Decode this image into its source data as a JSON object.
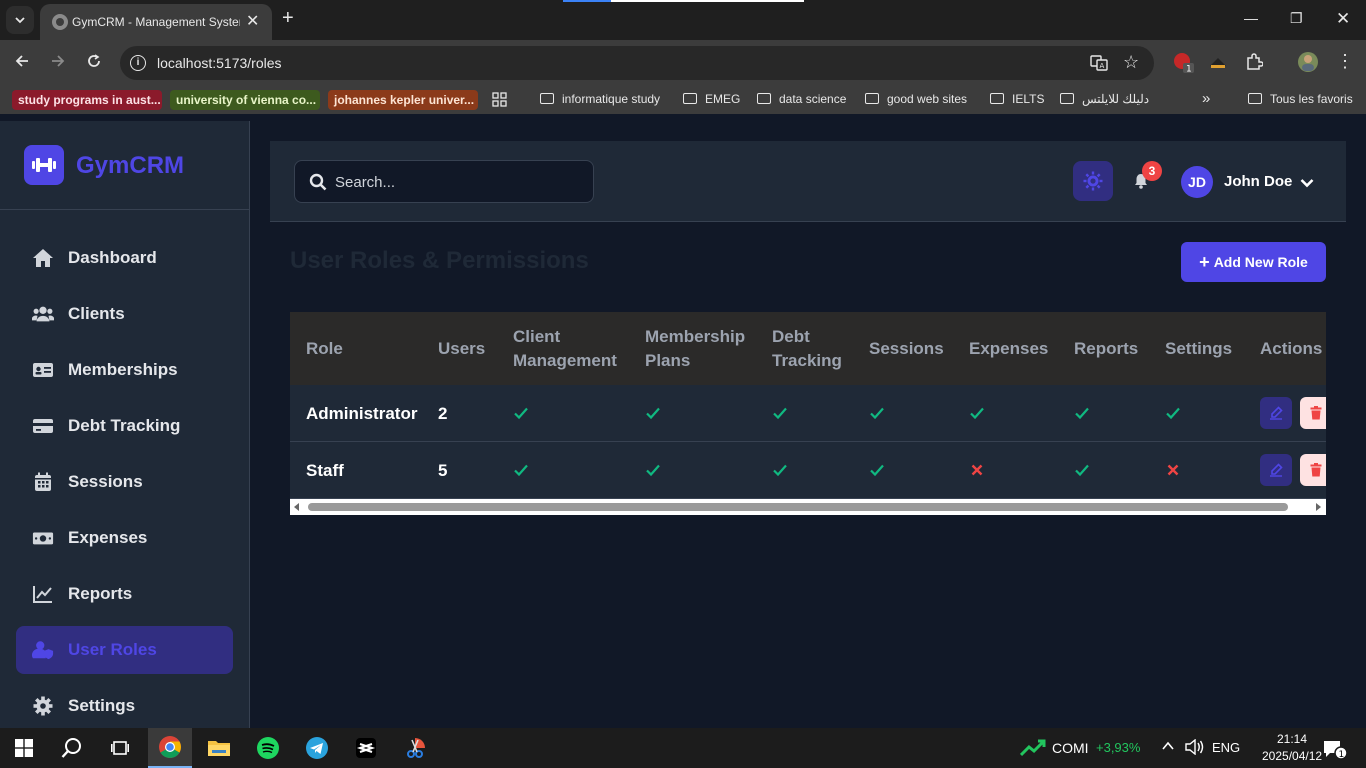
{
  "browser": {
    "tab_title": "GymCRM - Management System",
    "url": "localhost:5173/roles",
    "extension_badge": "1",
    "bookmarks_tagged": [
      {
        "label": "study programs in aust...",
        "color": "#8b1a2b"
      },
      {
        "label": "university of vienna co...",
        "color": "#3d5a1e"
      },
      {
        "label": "johannes kepler univer...",
        "color": "#8b3a1a"
      }
    ],
    "bookmark_folders": [
      "informatique study",
      "EMEG",
      "data science",
      "good web sites",
      "IELTS",
      "دليلك للايلتس"
    ],
    "bookmarks_more": "»",
    "all_bookmarks": "Tous les favoris"
  },
  "app": {
    "brand": "GymCRM",
    "accent": "#4f46e5"
  },
  "sidebar": {
    "items": [
      {
        "label": "Dashboard",
        "icon": "home-icon"
      },
      {
        "label": "Clients",
        "icon": "users-icon"
      },
      {
        "label": "Memberships",
        "icon": "id-card-icon"
      },
      {
        "label": "Debt Tracking",
        "icon": "credit-card-icon"
      },
      {
        "label": "Sessions",
        "icon": "calendar-icon"
      },
      {
        "label": "Expenses",
        "icon": "money-icon"
      },
      {
        "label": "Reports",
        "icon": "chart-line-icon"
      },
      {
        "label": "User Roles",
        "icon": "user-shield-icon",
        "active": true
      },
      {
        "label": "Settings",
        "icon": "gear-icon"
      }
    ]
  },
  "header": {
    "search_placeholder": "Search...",
    "notification_count": "3",
    "user_initials": "JD",
    "user_name": "John Doe"
  },
  "page": {
    "title": "User Roles & Permissions",
    "add_button": "Add New Role"
  },
  "table": {
    "headers": [
      "Role",
      "Users",
      "Client Management",
      "Membership Plans",
      "Debt Tracking",
      "Sessions",
      "Expenses",
      "Reports",
      "Settings",
      "Actions"
    ],
    "header_lines": [
      [
        "Role"
      ],
      [
        "Users"
      ],
      [
        "Client",
        "Management"
      ],
      [
        "Membership",
        "Plans"
      ],
      [
        "Debt",
        "Tracking"
      ],
      [
        "Sessions"
      ],
      [
        "Expenses"
      ],
      [
        "Reports"
      ],
      [
        "Settings"
      ],
      [
        "Actions"
      ]
    ],
    "rows": [
      {
        "role": "Administrator",
        "users": "2",
        "permissions": [
          true,
          true,
          true,
          true,
          true,
          true,
          true
        ]
      },
      {
        "role": "Staff",
        "users": "5",
        "permissions": [
          true,
          true,
          true,
          true,
          false,
          true,
          false
        ]
      }
    ]
  },
  "taskbar": {
    "stock_name": "COMI",
    "stock_change": "+3,93%",
    "language": "ENG",
    "time": "21:14",
    "date": "2025/04/12",
    "notifications": "1"
  }
}
